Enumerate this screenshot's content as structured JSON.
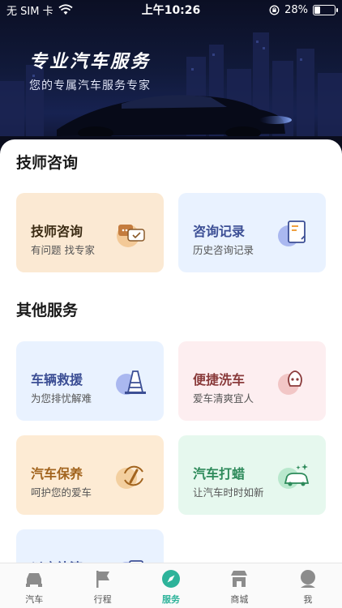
{
  "status_bar": {
    "carrier": "无 SIM 卡",
    "time": "上午10:26",
    "battery": "28%",
    "battery_level": 0.28
  },
  "banner": {
    "title": "专业汽车服务",
    "subtitle": "您的专属汽车服务专家"
  },
  "sections": {
    "consult": {
      "title": "技师咨询",
      "cards": [
        {
          "title": "技师咨询",
          "subtitle": "有问题 找专家",
          "icon": "chat-bubbles-icon"
        },
        {
          "title": "咨询记录",
          "subtitle": "历史咨询记录",
          "icon": "document-record-icon"
        }
      ]
    },
    "other": {
      "title": "其他服务",
      "cards": [
        {
          "title": "车辆救援",
          "subtitle": "为您排忧解难",
          "icon": "traffic-cone-icon"
        },
        {
          "title": "便捷洗车",
          "subtitle": "爱车清爽宜人",
          "icon": "car-wash-icon"
        },
        {
          "title": "汽车保养",
          "subtitle": "呵护您的爱车",
          "icon": "maintenance-wrench-icon"
        },
        {
          "title": "汽车打蜡",
          "subtitle": "让汽车时时如新",
          "icon": "car-wax-sparkle-icon"
        },
        {
          "title": "以店补漆",
          "subtitle": "",
          "icon": "paint-icon"
        }
      ]
    }
  },
  "tabbar": {
    "items": [
      {
        "label": "汽车",
        "icon": "car-icon"
      },
      {
        "label": "行程",
        "icon": "flag-icon"
      },
      {
        "label": "服务",
        "icon": "compass-icon",
        "active": true
      },
      {
        "label": "商城",
        "icon": "store-icon"
      },
      {
        "label": "我",
        "icon": "profile-icon"
      }
    ]
  },
  "colors": {
    "accent": "#2db39a",
    "banner_dark": "#0b0f24"
  }
}
